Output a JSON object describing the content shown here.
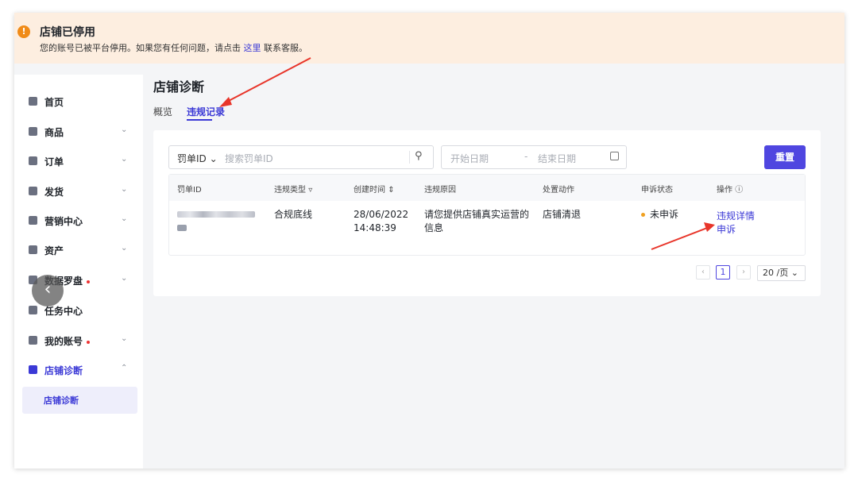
{
  "banner": {
    "title": "店铺已停用",
    "message_prefix": "您的账号已被平台停用。如果您有任何问题，请点击",
    "link": "这里",
    "message_suffix": "联系客服。",
    "icon": "warning-icon",
    "color": "#f08b18"
  },
  "sidebar": {
    "items": [
      {
        "label": "首页",
        "icon": "home-icon",
        "has_chevron": false,
        "dot": false
      },
      {
        "label": "商品",
        "icon": "product-icon",
        "has_chevron": true,
        "dot": false
      },
      {
        "label": "订单",
        "icon": "order-icon",
        "has_chevron": true,
        "dot": false
      },
      {
        "label": "发货",
        "icon": "shipping-icon",
        "has_chevron": true,
        "dot": false
      },
      {
        "label": "营销中心",
        "icon": "marketing-icon",
        "has_chevron": true,
        "dot": false
      },
      {
        "label": "资产",
        "icon": "wallet-icon",
        "has_chevron": true,
        "dot": false
      },
      {
        "label": "数据罗盘",
        "icon": "chart-icon",
        "has_chevron": true,
        "dot": true
      },
      {
        "label": "任务中心",
        "icon": "medal-icon",
        "has_chevron": false,
        "dot": false
      },
      {
        "label": "我的账号",
        "icon": "user-icon",
        "has_chevron": true,
        "dot": true
      },
      {
        "label": "店铺诊断",
        "icon": "shop-diagnosis-icon",
        "has_chevron": true,
        "dot": false,
        "active": true
      }
    ],
    "sub_item": "店铺诊断"
  },
  "page": {
    "title": "店铺诊断",
    "tabs": [
      {
        "label": "概览",
        "active": false
      },
      {
        "label": "违规记录",
        "active": true
      }
    ]
  },
  "filters": {
    "select_label": "罚单ID",
    "search_placeholder": "搜索罚单ID",
    "date_start_placeholder": "开始日期",
    "date_separator": "-",
    "date_end_placeholder": "结束日期",
    "reset_label": "重置"
  },
  "table": {
    "columns": [
      "罚单ID",
      "违规类型",
      "创建时间",
      "违规原因",
      "处置动作",
      "申诉状态",
      "操作"
    ],
    "rows": [
      {
        "violation_type": "合规底线",
        "created_date": "28/06/2022",
        "created_time": "14:48:39",
        "reason_line1": "请您提供店铺真实运营的",
        "reason_line2": "信息",
        "action_taken": "店铺清退",
        "appeal_status": "未申诉",
        "op_detail": "违规详情",
        "op_appeal": "申诉"
      }
    ]
  },
  "pagination": {
    "current_page": "1",
    "page_size": "20 /页"
  },
  "colors": {
    "accent": "#4f46e0",
    "link": "#3b39d6",
    "banner_bg": "#fdeee0",
    "annotation_arrow": "#e8352a"
  }
}
